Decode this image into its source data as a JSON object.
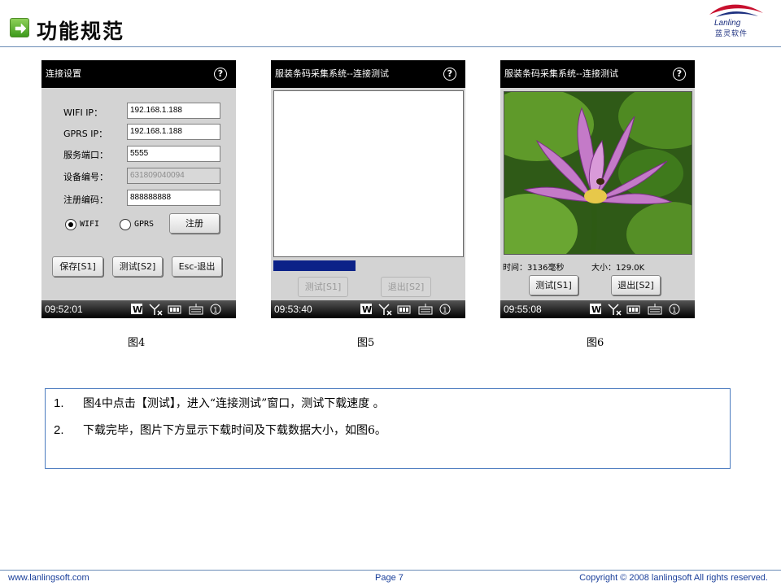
{
  "header": {
    "title": "功能规范",
    "logo_name": "Lanling",
    "logo_cn": "蓝灵软件",
    "logo_mark": "®"
  },
  "figures": [
    {
      "caption": "图4",
      "title": "连接设置",
      "help": "?",
      "fields": [
        {
          "label": "WIFI  IP：",
          "value": "192.168.1.188",
          "readonly": false
        },
        {
          "label": "GPRS  IP：",
          "value": "192.168.1.188",
          "readonly": false
        },
        {
          "label": "服务端口：",
          "value": "5555",
          "readonly": false
        },
        {
          "label": "设备编号：",
          "value": "631809040094",
          "readonly": true
        },
        {
          "label": "注册编码：",
          "value": "888888888",
          "readonly": false
        }
      ],
      "radio_wifi": "WIFI",
      "radio_gprs": "GPRS",
      "register_button": "注册",
      "buttons": [
        "保存[S1]",
        "测试[S2]",
        "Esc-退出"
      ],
      "time": "09:52:01"
    },
    {
      "caption": "图5",
      "title": "服装条码采集系统--连接测试",
      "help": "?",
      "progress": 0.43,
      "buttons": [
        "测试[S1]",
        "退出[S2]"
      ],
      "time": "09:53:40"
    },
    {
      "caption": "图6",
      "title": "服装条码采集系统--连接测试",
      "help": "?",
      "time_label": "时间：3136毫秒",
      "size_label": "大小：129.0K",
      "buttons": [
        "测试[S1]",
        "退出[S2]"
      ],
      "time": "09:55:08"
    }
  ],
  "notes": [
    {
      "num": "1.",
      "text": "图4中点击【测试】，进入“连接测试”窗口，测试下载速度 。"
    },
    {
      "num": "2.",
      "text": "下载完毕，图片下方显示下载时间及下载数据大小，如图6。"
    }
  ],
  "footer": {
    "website": "www.lanlingsoft.com",
    "page": "Page 7",
    "copyright": "Copyright © 2008 lanlingsoft All rights reserved."
  },
  "colors": {
    "title_bar": "#000000",
    "screen_bg": "#d3d3d3",
    "progress": "#0c2288",
    "accent_line": "#6a8cb6",
    "footer_text": "#1a3f9a"
  },
  "icons": {
    "title_bullet": "green-arrow-icon",
    "status": [
      "windows-flag-icon",
      "signal-off-icon",
      "battery-icon",
      "keyboard-icon",
      "notification-icon"
    ]
  }
}
